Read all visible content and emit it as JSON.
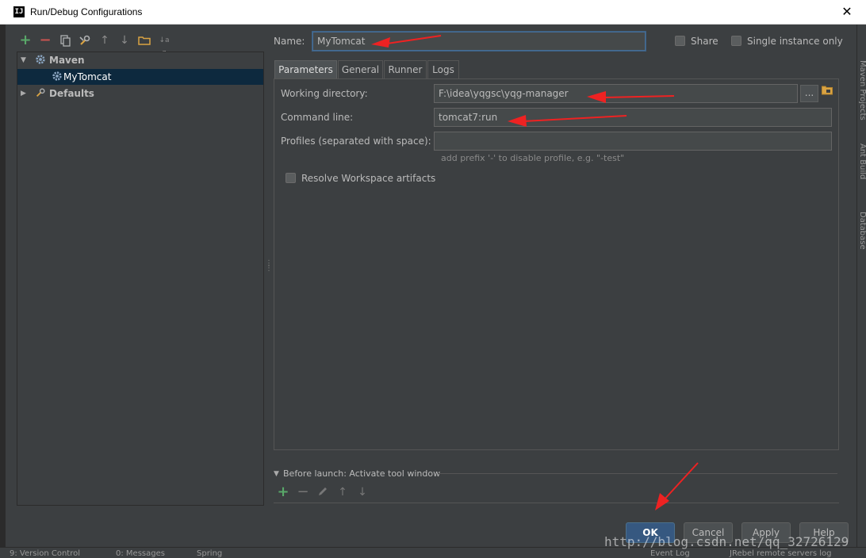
{
  "window": {
    "title": "Run/Debug Configurations",
    "app_icon_text": "IJ",
    "close_glyph": "✕"
  },
  "toolbar": {
    "add": "+",
    "remove": "−",
    "copy_icon": "copy-icon",
    "edit_defaults_icon": "wrench-icon",
    "move_up": "↑",
    "move_down": "↓",
    "folder_icon": "folder-icon",
    "sort": "↓a z"
  },
  "tree": {
    "items": [
      {
        "label": "Maven",
        "expanded": true,
        "icon": "gear-icon"
      },
      {
        "label": "MyTomcat",
        "selected": true,
        "icon": "gear-icon"
      },
      {
        "label": "Defaults",
        "expanded": false,
        "icon": "wrench-icon"
      }
    ]
  },
  "name_row": {
    "label": "Name:",
    "value": "MyTomcat",
    "share_label": "Share",
    "single_instance_label": "Single instance only"
  },
  "tabs": [
    {
      "label": "Parameters",
      "active": true
    },
    {
      "label": "General",
      "active": false
    },
    {
      "label": "Runner",
      "active": false
    },
    {
      "label": "Logs",
      "active": false
    }
  ],
  "parameters": {
    "working_dir_label": "Working directory:",
    "working_dir_value": "F:\\idea\\yqgsc\\yqg-manager",
    "browse_label": "...",
    "command_line_label": "Command line:",
    "command_line_value": "tomcat7:run",
    "profiles_label": "Profiles (separated with space):",
    "profiles_value": "",
    "profiles_hint": "add prefix '-' to disable profile, e.g. \"-test\"",
    "resolve_label": "Resolve Workspace artifacts"
  },
  "before_launch": {
    "title": "Before launch: Activate tool window"
  },
  "buttons": {
    "ok": "OK",
    "cancel": "Cancel",
    "apply": "Apply",
    "help": "Help"
  },
  "background_ide": {
    "right_tools": [
      "Maven Projects",
      "Ant Build",
      "Database"
    ],
    "status_items": [
      "9: Version Control",
      "0: Messages",
      "Spring",
      "Event Log",
      "JRebel remote servers log"
    ]
  },
  "watermark": "http://blog.csdn.net/qq_32726129",
  "colors": {
    "background": "#3c3f41",
    "selection": "#0d293e",
    "accent": "#365880",
    "annotation_red": "#ee2222",
    "add_green": "#59a869",
    "remove_red": "#c75450"
  }
}
